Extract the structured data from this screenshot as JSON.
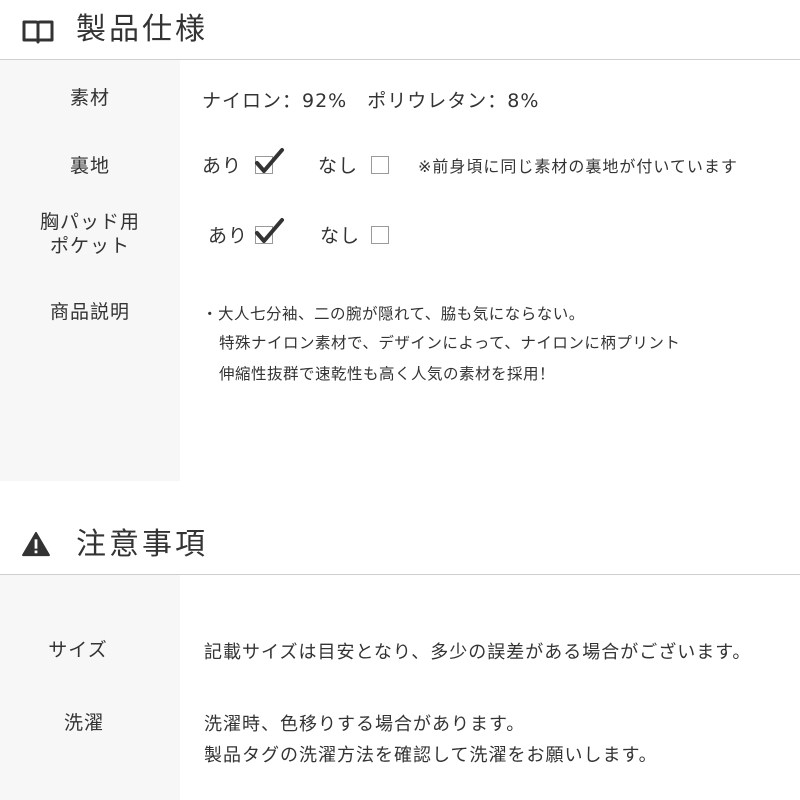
{
  "specs": {
    "title": "製品仕様",
    "material": {
      "label": "素材",
      "value": "ナイロン：92%　ポリウレタン：8%"
    },
    "lining": {
      "label": "裏地",
      "yes_label": "あり",
      "yes_checked": true,
      "no_label": "なし",
      "no_checked": false,
      "note": "※前身頃に同じ素材の裏地が付いています"
    },
    "pad_pocket": {
      "label_line1": "胸パッド用",
      "label_line2": "ポケット",
      "yes_label": "あり",
      "yes_checked": true,
      "no_label": "なし",
      "no_checked": false
    },
    "description": {
      "label": "商品説明",
      "lines": [
        "・大人七分袖、二の腕が隠れて、脇も気にならない。",
        "特殊ナイロン素材で、デザインによって、ナイロンに柄プリント",
        "伸縮性抜群で速乾性も高く人気の素材を採用！"
      ]
    }
  },
  "notes": {
    "title": "注意事項",
    "size": {
      "label": "サイズ",
      "value": "記載サイズは目安となり、多少の誤差がある場合がございます。"
    },
    "washing": {
      "label": "洗濯",
      "lines": [
        "洗濯時、色移りする場合があります。",
        "製品タグの洗濯方法を確認して洗濯をお願いします。"
      ]
    }
  },
  "icons": {
    "specs_icon": "open-book-icon",
    "notes_icon": "warning-icon"
  },
  "colors": {
    "text": "#333333",
    "label_bg": "#f7f7f7",
    "divider": "#cfcfcf",
    "checkbox_border": "#9a9a9a"
  }
}
